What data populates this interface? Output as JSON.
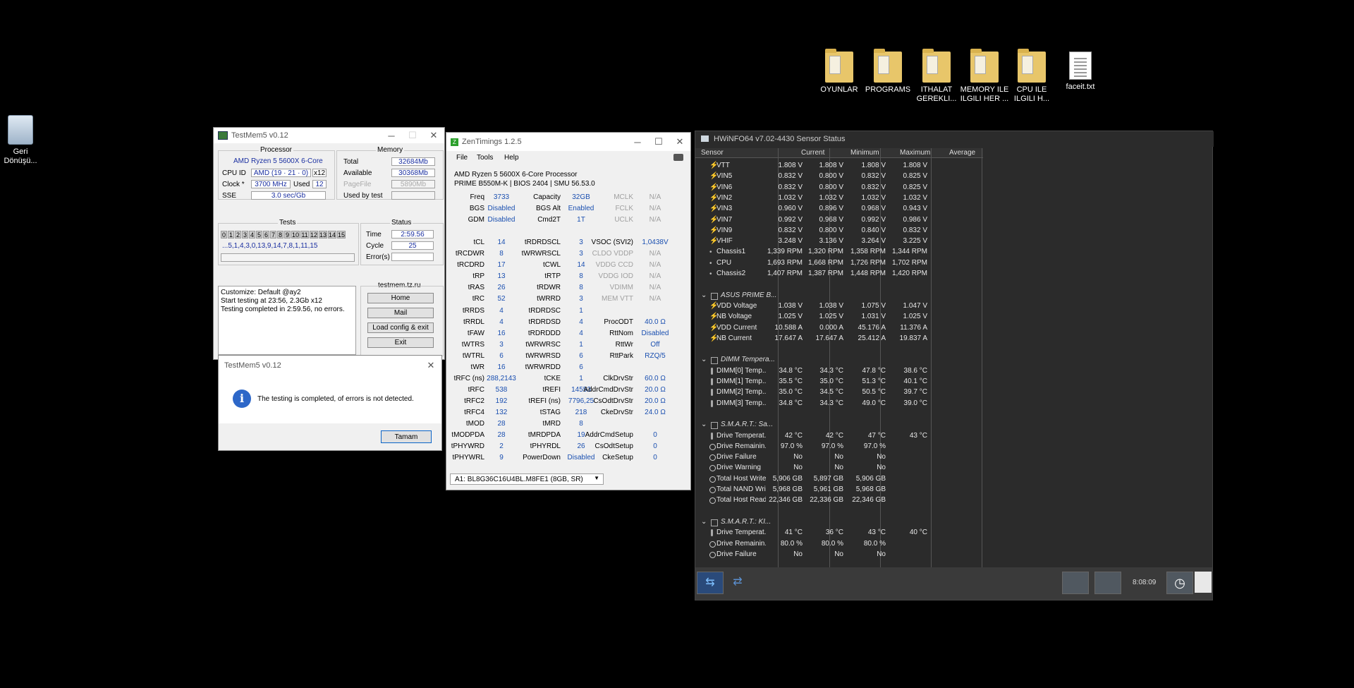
{
  "desktop": {
    "icons": [
      {
        "label": "OYUNLAR",
        "kind": "folder"
      },
      {
        "label": "PROGRAMS",
        "kind": "folder"
      },
      {
        "label": "ITHALAT GEREKLI...",
        "kind": "folder"
      },
      {
        "label": "MEMORY ILE ILGILI HER ...",
        "kind": "folder"
      },
      {
        "label": "CPU ILE ILGILI H...",
        "kind": "folder"
      },
      {
        "label": "faceit.txt",
        "kind": "file"
      }
    ],
    "recycle_bin": "Geri Dönüşü..."
  },
  "testmem": {
    "title": "TestMem5 v0.12",
    "processor_group": "Processor",
    "cpu_name": "AMD Ryzen 5 5600X 6-Core",
    "cpu_id_label": "CPU ID",
    "cpu_id": "AMD (19 · 21 · 0)",
    "cpu_threads": "x12",
    "clock_label": "Clock *",
    "clock": "3700 MHz",
    "used_label": "Used",
    "used": "12",
    "sse_label": "SSE",
    "sse": "3.0 sec/Gb",
    "memory_group": "Memory",
    "total_label": "Total",
    "total": "32684Mb",
    "available_label": "Available",
    "available": "30368Mb",
    "pagefile_label": "PageFile",
    "pagefile": "5890Mb",
    "usedbytest_label": "Used by test",
    "tests_group": "Tests",
    "test_cells": [
      "0",
      "1",
      "2",
      "3",
      "4",
      "5",
      "6",
      "7",
      "8",
      "9",
      "10",
      "11",
      "12",
      "13",
      "14",
      "15"
    ],
    "test_sequence": "...5,1,4,3,0,13,9,14,7,8,1,11,15",
    "status_group": "Status",
    "time_label": "Time",
    "time": "2:59.56",
    "cycle_label": "Cycle",
    "cycle": "25",
    "errors_label": "Error(s)",
    "log": [
      "Customize: Default @ay2",
      "Start testing at 23:56, 2.3Gb x12",
      "Testing completed in 2:59.56, no errors."
    ],
    "site": "testmem.tz.ru",
    "buttons": {
      "home": "Home",
      "mail": "Mail",
      "load": "Load config & exit",
      "exit": "Exit"
    }
  },
  "dialog": {
    "title": "TestMem5 v0.12",
    "message": "The testing is completed, of errors is not detected.",
    "ok": "Tamam"
  },
  "zen": {
    "title": "ZenTimings 1.2.5",
    "menu": [
      "File",
      "Tools",
      "Help"
    ],
    "cpu": "AMD Ryzen 5 5600X 6-Core Processor",
    "board": "PRIME B550M-K | BIOS 2404 | SMU 56.53.0",
    "col1": [
      [
        "Freq",
        "3733"
      ],
      [
        "BGS",
        "Disabled"
      ],
      [
        "GDM",
        "Disabled"
      ],
      [
        "",
        ""
      ],
      [
        "tCL",
        "14"
      ],
      [
        "tRCDWR",
        "8"
      ],
      [
        "tRCDRD",
        "17"
      ],
      [
        "tRP",
        "13"
      ],
      [
        "tRAS",
        "26"
      ],
      [
        "tRC",
        "52"
      ],
      [
        "tRRDS",
        "4"
      ],
      [
        "tRRDL",
        "4"
      ],
      [
        "tFAW",
        "16"
      ],
      [
        "tWTRS",
        "3"
      ],
      [
        "tWTRL",
        "6"
      ],
      [
        "tWR",
        "16"
      ],
      [
        "tRFC (ns)",
        "288,2143"
      ],
      [
        "tRFC",
        "538"
      ],
      [
        "tRFC2",
        "192"
      ],
      [
        "tRFC4",
        "132"
      ],
      [
        "tMOD",
        "28"
      ],
      [
        "tMODPDA",
        "28"
      ],
      [
        "tPHYWRD",
        "2"
      ],
      [
        "tPHYWRL",
        "9"
      ]
    ],
    "col2": [
      [
        "Capacity",
        "32GB"
      ],
      [
        "BGS Alt",
        "Enabled"
      ],
      [
        "Cmd2T",
        "1T"
      ],
      [
        "",
        ""
      ],
      [
        "tRDRDSCL",
        "3"
      ],
      [
        "tWRWRSCL",
        "3"
      ],
      [
        "tCWL",
        "14"
      ],
      [
        "tRTP",
        "8"
      ],
      [
        "tRDWR",
        "8"
      ],
      [
        "tWRRD",
        "3"
      ],
      [
        "tRDRDSC",
        "1"
      ],
      [
        "tRDRDSD",
        "4"
      ],
      [
        "tRDRDDD",
        "4"
      ],
      [
        "tWRWRSC",
        "1"
      ],
      [
        "tWRWRSD",
        "6"
      ],
      [
        "tWRWRDD",
        "6"
      ],
      [
        "tCKE",
        "1"
      ],
      [
        "tREFI",
        "14553"
      ],
      [
        "tREFI (ns)",
        "7796,25"
      ],
      [
        "tSTAG",
        "218"
      ],
      [
        "tMRD",
        "8"
      ],
      [
        "tMRDPDA",
        "19"
      ],
      [
        "tPHYRDL",
        "26"
      ],
      [
        "PowerDown",
        "Disabled"
      ]
    ],
    "col3": [
      [
        "MCLK",
        "N/A"
      ],
      [
        "FCLK",
        "N/A"
      ],
      [
        "UCLK",
        "N/A"
      ],
      [
        "",
        ""
      ],
      [
        "VSOC (SVI2)",
        "1,0438V"
      ],
      [
        "CLDO VDDP",
        "N/A"
      ],
      [
        "VDDG CCD",
        "N/A"
      ],
      [
        "VDDG IOD",
        "N/A"
      ],
      [
        "VDIMM",
        "N/A"
      ],
      [
        "MEM VTT",
        "N/A"
      ],
      [
        "",
        ""
      ],
      [
        "ProcODT",
        "40.0 Ω"
      ],
      [
        "RttNom",
        "Disabled"
      ],
      [
        "RttWr",
        "Off"
      ],
      [
        "RttPark",
        "RZQ/5"
      ],
      [
        "",
        ""
      ],
      [
        "ClkDrvStr",
        "60.0 Ω"
      ],
      [
        "AddrCmdDrvStr",
        "20.0 Ω"
      ],
      [
        "CsOdtDrvStr",
        "20.0 Ω"
      ],
      [
        "CkeDrvStr",
        "24.0 Ω"
      ],
      [
        "",
        ""
      ],
      [
        "AddrCmdSetup",
        "0"
      ],
      [
        "CsOdtSetup",
        "0"
      ],
      [
        "CkeSetup",
        "0"
      ]
    ],
    "module": "A1: BL8G36C16U4BL.M8FE1 (8GB, SR)"
  },
  "hwinfo": {
    "title": "HWiNFO64 v7.02-4430 Sensor Status",
    "headers": {
      "sensor": "Sensor",
      "current": "Current",
      "min": "Minimum",
      "max": "Maximum",
      "avg": "Average"
    },
    "rows": [
      {
        "t": "v",
        "n": "VTT",
        "c": "1.808 V",
        "mi": "1.808 V",
        "ma": "1.808 V",
        "av": "1.808 V"
      },
      {
        "t": "v",
        "n": "VIN5",
        "c": "0.832 V",
        "mi": "0.800 V",
        "ma": "0.832 V",
        "av": "0.825 V"
      },
      {
        "t": "v",
        "n": "VIN6",
        "c": "0.832 V",
        "mi": "0.800 V",
        "ma": "0.832 V",
        "av": "0.825 V"
      },
      {
        "t": "v",
        "n": "VIN2",
        "c": "1.032 V",
        "mi": "1.032 V",
        "ma": "1.032 V",
        "av": "1.032 V"
      },
      {
        "t": "v",
        "n": "VIN3",
        "c": "0.960 V",
        "mi": "0.896 V",
        "ma": "0.968 V",
        "av": "0.943 V"
      },
      {
        "t": "v",
        "n": "VIN7",
        "c": "0.992 V",
        "mi": "0.968 V",
        "ma": "0.992 V",
        "av": "0.986 V"
      },
      {
        "t": "v",
        "n": "VIN9",
        "c": "0.832 V",
        "mi": "0.800 V",
        "ma": "0.840 V",
        "av": "0.832 V"
      },
      {
        "t": "v",
        "n": "VHIF",
        "c": "3.248 V",
        "mi": "3.136 V",
        "ma": "3.264 V",
        "av": "3.225 V"
      },
      {
        "t": "f",
        "n": "Chassis1",
        "c": "1,339 RPM",
        "mi": "1,320 RPM",
        "ma": "1,358 RPM",
        "av": "1,344 RPM"
      },
      {
        "t": "f",
        "n": "CPU",
        "c": "1,693 RPM",
        "mi": "1,668 RPM",
        "ma": "1,726 RPM",
        "av": "1,702 RPM"
      },
      {
        "t": "f",
        "n": "Chassis2",
        "c": "1,407 RPM",
        "mi": "1,387 RPM",
        "ma": "1,448 RPM",
        "av": "1,420 RPM"
      },
      {
        "t": "e"
      },
      {
        "t": "g",
        "n": "ASUS PRIME B..."
      },
      {
        "t": "v",
        "n": "VDD Voltage",
        "c": "1.038 V",
        "mi": "1.038 V",
        "ma": "1.075 V",
        "av": "1.047 V"
      },
      {
        "t": "v",
        "n": "NB Voltage",
        "c": "1.025 V",
        "mi": "1.025 V",
        "ma": "1.031 V",
        "av": "1.025 V"
      },
      {
        "t": "v",
        "n": "VDD Current",
        "c": "10.588 A",
        "mi": "0.000 A",
        "ma": "45.176 A",
        "av": "11.376 A"
      },
      {
        "t": "v",
        "n": "NB Current",
        "c": "17.647 A",
        "mi": "17.647 A",
        "ma": "25.412 A",
        "av": "19.837 A"
      },
      {
        "t": "e"
      },
      {
        "t": "g",
        "n": "DIMM Tempera..."
      },
      {
        "t": "tmp",
        "n": "DIMM[0] Temp...",
        "c": "34.8 °C",
        "mi": "34.3 °C",
        "ma": "47.8 °C",
        "av": "38.6 °C"
      },
      {
        "t": "tmp",
        "n": "DIMM[1] Temp...",
        "c": "35.5 °C",
        "mi": "35.0 °C",
        "ma": "51.3 °C",
        "av": "40.1 °C"
      },
      {
        "t": "tmp",
        "n": "DIMM[2] Temp...",
        "c": "35.0 °C",
        "mi": "34.5 °C",
        "ma": "50.5 °C",
        "av": "39.7 °C"
      },
      {
        "t": "tmp",
        "n": "DIMM[3] Temp...",
        "c": "34.8 °C",
        "mi": "34.3 °C",
        "ma": "49.0 °C",
        "av": "39.0 °C"
      },
      {
        "t": "e"
      },
      {
        "t": "g",
        "n": "S.M.A.R.T.: Sa..."
      },
      {
        "t": "tmp",
        "n": "Drive Temperat...",
        "c": "42 °C",
        "mi": "42 °C",
        "ma": "47 °C",
        "av": "43 °C"
      },
      {
        "t": "o",
        "n": "Drive Remainin...",
        "c": "97.0 %",
        "mi": "97.0 %",
        "ma": "97.0 %",
        "av": ""
      },
      {
        "t": "o",
        "n": "Drive Failure",
        "c": "No",
        "mi": "No",
        "ma": "No",
        "av": ""
      },
      {
        "t": "o",
        "n": "Drive Warning",
        "c": "No",
        "mi": "No",
        "ma": "No",
        "av": ""
      },
      {
        "t": "o",
        "n": "Total Host Writes",
        "c": "5,906 GB",
        "mi": "5,897 GB",
        "ma": "5,906 GB",
        "av": ""
      },
      {
        "t": "o",
        "n": "Total NAND Wri...",
        "c": "5,968 GB",
        "mi": "5,961 GB",
        "ma": "5,968 GB",
        "av": ""
      },
      {
        "t": "o",
        "n": "Total Host Reads",
        "c": "22,346 GB",
        "mi": "22,336 GB",
        "ma": "22,346 GB",
        "av": ""
      },
      {
        "t": "e"
      },
      {
        "t": "g",
        "n": "S.M.A.R.T.: KI..."
      },
      {
        "t": "tmp",
        "n": "Drive Temperat...",
        "c": "41 °C",
        "mi": "36 °C",
        "ma": "43 °C",
        "av": "40 °C"
      },
      {
        "t": "o",
        "n": "Drive Remainin...",
        "c": "80.0 %",
        "mi": "80.0 %",
        "ma": "80.0 %",
        "av": ""
      },
      {
        "t": "o",
        "n": "Drive Failure",
        "c": "No",
        "mi": "No",
        "ma": "No",
        "av": ""
      }
    ],
    "clock": "8:08:09"
  }
}
